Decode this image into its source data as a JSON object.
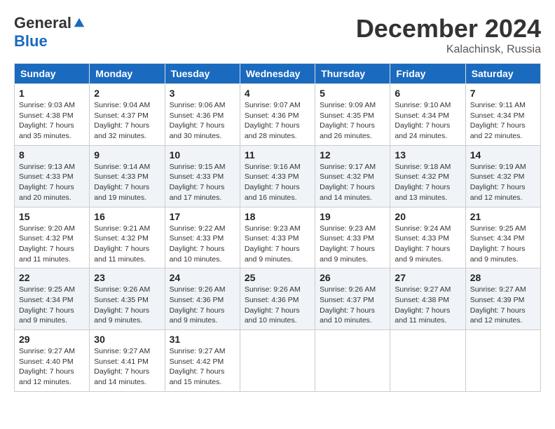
{
  "logo": {
    "general": "General",
    "blue": "Blue"
  },
  "title": "December 2024",
  "location": "Kalachinsk, Russia",
  "headers": [
    "Sunday",
    "Monday",
    "Tuesday",
    "Wednesday",
    "Thursday",
    "Friday",
    "Saturday"
  ],
  "weeks": [
    [
      {
        "day": "1",
        "info": "Sunrise: 9:03 AM\nSunset: 4:38 PM\nDaylight: 7 hours\nand 35 minutes."
      },
      {
        "day": "2",
        "info": "Sunrise: 9:04 AM\nSunset: 4:37 PM\nDaylight: 7 hours\nand 32 minutes."
      },
      {
        "day": "3",
        "info": "Sunrise: 9:06 AM\nSunset: 4:36 PM\nDaylight: 7 hours\nand 30 minutes."
      },
      {
        "day": "4",
        "info": "Sunrise: 9:07 AM\nSunset: 4:36 PM\nDaylight: 7 hours\nand 28 minutes."
      },
      {
        "day": "5",
        "info": "Sunrise: 9:09 AM\nSunset: 4:35 PM\nDaylight: 7 hours\nand 26 minutes."
      },
      {
        "day": "6",
        "info": "Sunrise: 9:10 AM\nSunset: 4:34 PM\nDaylight: 7 hours\nand 24 minutes."
      },
      {
        "day": "7",
        "info": "Sunrise: 9:11 AM\nSunset: 4:34 PM\nDaylight: 7 hours\nand 22 minutes."
      }
    ],
    [
      {
        "day": "8",
        "info": "Sunrise: 9:13 AM\nSunset: 4:33 PM\nDaylight: 7 hours\nand 20 minutes."
      },
      {
        "day": "9",
        "info": "Sunrise: 9:14 AM\nSunset: 4:33 PM\nDaylight: 7 hours\nand 19 minutes."
      },
      {
        "day": "10",
        "info": "Sunrise: 9:15 AM\nSunset: 4:33 PM\nDaylight: 7 hours\nand 17 minutes."
      },
      {
        "day": "11",
        "info": "Sunrise: 9:16 AM\nSunset: 4:33 PM\nDaylight: 7 hours\nand 16 minutes."
      },
      {
        "day": "12",
        "info": "Sunrise: 9:17 AM\nSunset: 4:32 PM\nDaylight: 7 hours\nand 14 minutes."
      },
      {
        "day": "13",
        "info": "Sunrise: 9:18 AM\nSunset: 4:32 PM\nDaylight: 7 hours\nand 13 minutes."
      },
      {
        "day": "14",
        "info": "Sunrise: 9:19 AM\nSunset: 4:32 PM\nDaylight: 7 hours\nand 12 minutes."
      }
    ],
    [
      {
        "day": "15",
        "info": "Sunrise: 9:20 AM\nSunset: 4:32 PM\nDaylight: 7 hours\nand 11 minutes."
      },
      {
        "day": "16",
        "info": "Sunrise: 9:21 AM\nSunset: 4:32 PM\nDaylight: 7 hours\nand 11 minutes."
      },
      {
        "day": "17",
        "info": "Sunrise: 9:22 AM\nSunset: 4:33 PM\nDaylight: 7 hours\nand 10 minutes."
      },
      {
        "day": "18",
        "info": "Sunrise: 9:23 AM\nSunset: 4:33 PM\nDaylight: 7 hours\nand 9 minutes."
      },
      {
        "day": "19",
        "info": "Sunrise: 9:23 AM\nSunset: 4:33 PM\nDaylight: 7 hours\nand 9 minutes."
      },
      {
        "day": "20",
        "info": "Sunrise: 9:24 AM\nSunset: 4:33 PM\nDaylight: 7 hours\nand 9 minutes."
      },
      {
        "day": "21",
        "info": "Sunrise: 9:25 AM\nSunset: 4:34 PM\nDaylight: 7 hours\nand 9 minutes."
      }
    ],
    [
      {
        "day": "22",
        "info": "Sunrise: 9:25 AM\nSunset: 4:34 PM\nDaylight: 7 hours\nand 9 minutes."
      },
      {
        "day": "23",
        "info": "Sunrise: 9:26 AM\nSunset: 4:35 PM\nDaylight: 7 hours\nand 9 minutes."
      },
      {
        "day": "24",
        "info": "Sunrise: 9:26 AM\nSunset: 4:36 PM\nDaylight: 7 hours\nand 9 minutes."
      },
      {
        "day": "25",
        "info": "Sunrise: 9:26 AM\nSunset: 4:36 PM\nDaylight: 7 hours\nand 10 minutes."
      },
      {
        "day": "26",
        "info": "Sunrise: 9:26 AM\nSunset: 4:37 PM\nDaylight: 7 hours\nand 10 minutes."
      },
      {
        "day": "27",
        "info": "Sunrise: 9:27 AM\nSunset: 4:38 PM\nDaylight: 7 hours\nand 11 minutes."
      },
      {
        "day": "28",
        "info": "Sunrise: 9:27 AM\nSunset: 4:39 PM\nDaylight: 7 hours\nand 12 minutes."
      }
    ],
    [
      {
        "day": "29",
        "info": "Sunrise: 9:27 AM\nSunset: 4:40 PM\nDaylight: 7 hours\nand 12 minutes."
      },
      {
        "day": "30",
        "info": "Sunrise: 9:27 AM\nSunset: 4:41 PM\nDaylight: 7 hours\nand 14 minutes."
      },
      {
        "day": "31",
        "info": "Sunrise: 9:27 AM\nSunset: 4:42 PM\nDaylight: 7 hours\nand 15 minutes."
      },
      null,
      null,
      null,
      null
    ]
  ]
}
